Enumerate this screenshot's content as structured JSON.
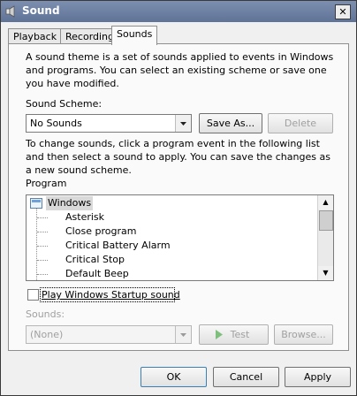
{
  "window": {
    "title": "Sound",
    "close_glyph": "✕"
  },
  "tabs": [
    {
      "label": "Playback"
    },
    {
      "label": "Recording"
    },
    {
      "label": "Sounds"
    }
  ],
  "sounds_tab": {
    "intro": "A sound theme is a set of sounds applied to events in Windows and programs. You can select an existing scheme or save one you have modified.",
    "scheme_label": "Sound Scheme:",
    "scheme_value": "No Sounds",
    "save_as_label": "Save As...",
    "delete_label": "Delete",
    "instructions": "To change sounds, click a program event in the following list and then select a sound to apply. You can save the changes as a new sound scheme.",
    "program_label": "Program",
    "program_items": [
      {
        "label": "Windows"
      },
      {
        "label": "Asterisk"
      },
      {
        "label": "Close program"
      },
      {
        "label": "Critical Battery Alarm"
      },
      {
        "label": "Critical Stop"
      },
      {
        "label": "Default Beep"
      }
    ],
    "startup_checkbox_label": "Play Windows Startup sound",
    "sounds_label": "Sounds:",
    "sounds_value": "(None)",
    "test_label": "Test",
    "browse_label": "Browse..."
  },
  "footer": {
    "ok_label": "OK",
    "cancel_label": "Cancel",
    "apply_label": "Apply"
  }
}
